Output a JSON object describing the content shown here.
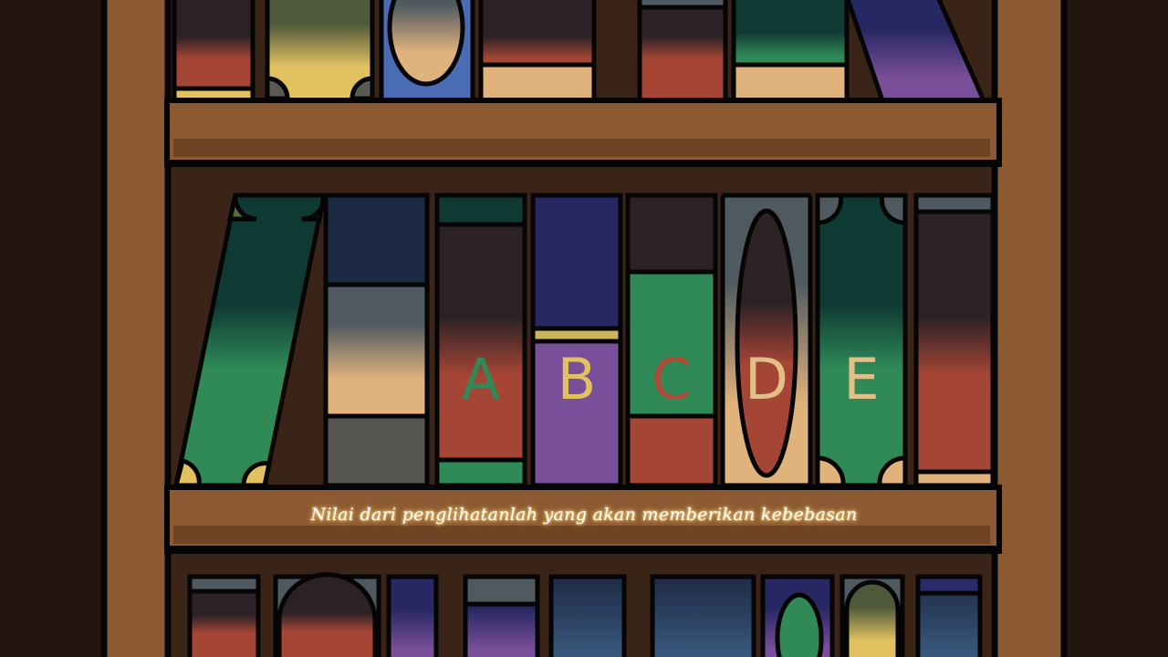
{
  "caption": "Nilai dari penglihatanlah yang akan memberikan kebebasan",
  "puzzle_books": [
    {
      "letter": "A",
      "letter_color": "#2f8a57"
    },
    {
      "letter": "B",
      "letter_color": "#e2c260"
    },
    {
      "letter": "C",
      "letter_color": "#b04a38"
    },
    {
      "letter": "D",
      "letter_color": "#e2bf86"
    },
    {
      "letter": "E",
      "letter_color": "#e2bf86"
    }
  ],
  "colors": {
    "wall": "#22150e",
    "shelf_wood": "#8c5a32",
    "shelf_back": "#3a2418",
    "outline": "#050505",
    "green": "#2f8a57",
    "dark_teal": "#0f3a34",
    "brown_red": "#a54535",
    "tan": "#e0b27c",
    "purple": "#7a4f9a",
    "navy": "#2a2a6a",
    "mustard": "#e2c260"
  }
}
